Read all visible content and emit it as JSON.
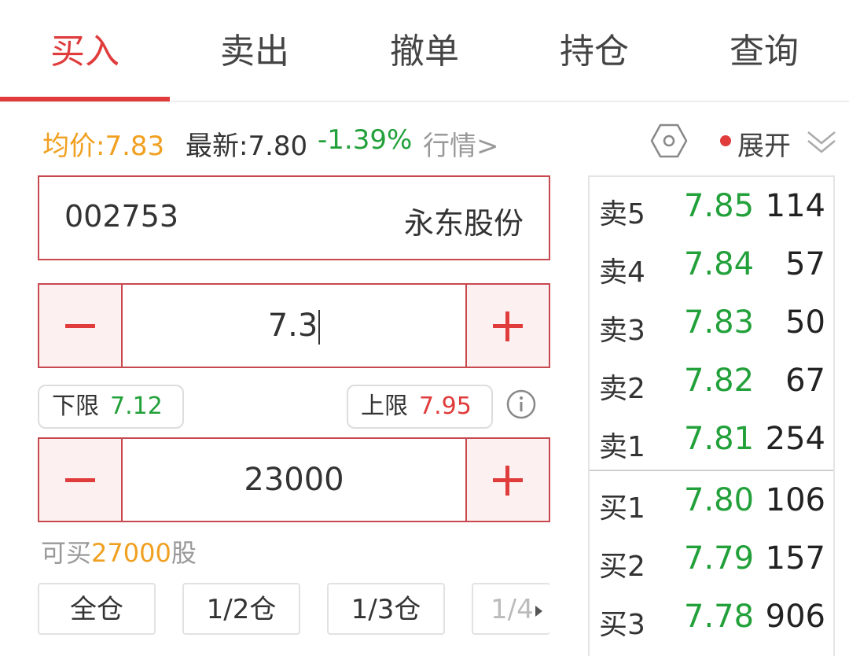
{
  "tabs": [
    {
      "label": "买入",
      "active": true
    },
    {
      "label": "卖出",
      "active": false
    },
    {
      "label": "撤单",
      "active": false
    },
    {
      "label": "持仓",
      "active": false
    },
    {
      "label": "查询",
      "active": false
    }
  ],
  "info": {
    "avg_price": "均价:7.83",
    "latest_price": "最新:7.80",
    "change": "-1.39%",
    "market_link": "行情>",
    "expand_label": "展开"
  },
  "stock": {
    "code": "002753",
    "name": "永东股份"
  },
  "price": {
    "value": "7.3"
  },
  "limits": {
    "lower_label": "下限",
    "lower_value": "7.12",
    "upper_label": "上限",
    "upper_value": "7.95"
  },
  "quantity": {
    "value": "23000"
  },
  "can_buy": {
    "prefix": "可买",
    "amount": "27000",
    "suffix": "股"
  },
  "position_buttons": [
    "全仓",
    "1/2仓",
    "1/3仓",
    "1/4"
  ],
  "order_book": {
    "asks": [
      {
        "level": "卖5",
        "price": "7.85",
        "volume": "114"
      },
      {
        "level": "卖4",
        "price": "7.84",
        "volume": "57"
      },
      {
        "level": "卖3",
        "price": "7.83",
        "volume": "50"
      },
      {
        "level": "卖2",
        "price": "7.82",
        "volume": "67"
      },
      {
        "level": "卖1",
        "price": "7.81",
        "volume": "254"
      }
    ],
    "bids": [
      {
        "level": "买1",
        "price": "7.80",
        "volume": "106"
      },
      {
        "level": "买2",
        "price": "7.79",
        "volume": "157"
      },
      {
        "level": "买3",
        "price": "7.78",
        "volume": "906"
      }
    ]
  },
  "colors": {
    "accent": "#e03c3c",
    "up": "#e03c3c",
    "down": "#22a03a",
    "highlight": "#f0a020"
  }
}
